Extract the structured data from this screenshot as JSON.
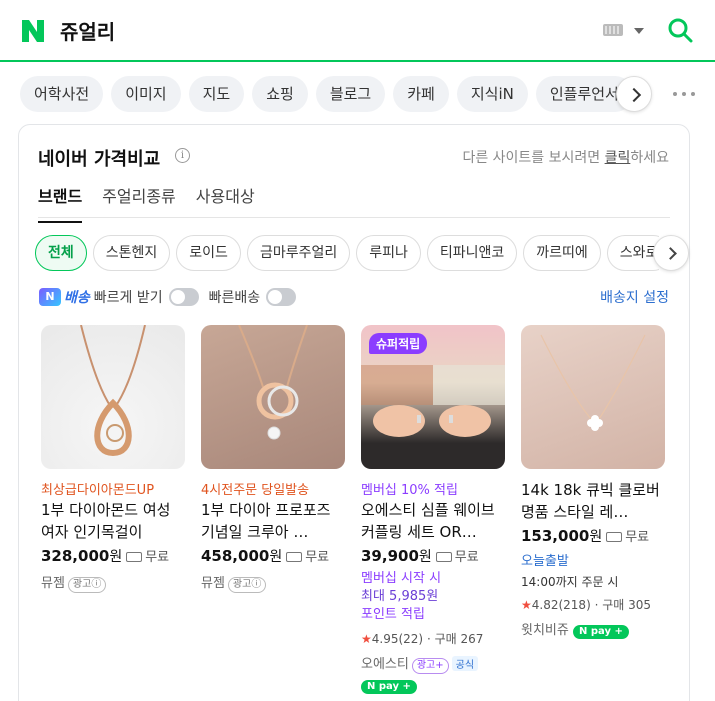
{
  "header": {
    "query": "쥬얼리",
    "colors": {
      "brand": "#03c75a"
    }
  },
  "tabs": [
    "어학사전",
    "이미지",
    "지도",
    "쇼핑",
    "블로그",
    "카페",
    "지식iN",
    "인플루언서"
  ],
  "card": {
    "title": "네이버 가격비교",
    "notice_prefix": "다른 사이트를 보시려면 ",
    "notice_link": "클릭",
    "notice_suffix": "하세요",
    "subtabs": [
      "브랜드",
      "주얼리종류",
      "사용대상"
    ],
    "chips": [
      "전체",
      "스톤헨지",
      "로이드",
      "금마루주얼리",
      "루피나",
      "티파니앤코",
      "까르띠에",
      "스와로"
    ],
    "filters": {
      "fast_delivery_brand": "배송",
      "fast_delivery_label": "빠르게 받기",
      "fast_shipping_label": "빠른배송",
      "address_setting": "배송지 설정"
    }
  },
  "products": [
    {
      "promo": "최상급다이아몬드UP",
      "name": "1부 다이아몬드 여성 여자 인기목걸이",
      "price": "328,000",
      "price_unit": "원",
      "shipping": "무료",
      "seller": "뮤젬",
      "ad": "광고"
    },
    {
      "promo": "4시전주문 당일발송",
      "name": "1부 다이아 프로포즈 기념일 크루아 …",
      "price": "458,000",
      "price_unit": "원",
      "shipping": "무료",
      "seller": "뮤젬",
      "ad": "광고"
    },
    {
      "badge": "슈퍼적립",
      "promo": "멤버십 10% 적립",
      "name": "오에스티 심플 웨이브 커플링 세트 OR…",
      "price": "39,900",
      "price_unit": "원",
      "shipping": "무료",
      "extra1": "멤버십 시작 시",
      "extra2": "최대 5,985원",
      "extra3": "포인트 적립",
      "rating": "4.95",
      "reviews": "(22)",
      "purchases": "구매 267",
      "seller": "오에스티",
      "ad": "광고+",
      "official": "공식",
      "npay": "pay"
    },
    {
      "name": "14k 18k 큐빅 클로버 명품 스타일 레…",
      "price": "153,000",
      "price_unit": "원",
      "shipping": "무료",
      "today": "오늘출발",
      "deadline": "14:00까지 주문 시",
      "rating": "4.82",
      "reviews": "(218)",
      "purchases": "구매 305",
      "seller": "윗치비쥬",
      "npay": "pay"
    }
  ]
}
